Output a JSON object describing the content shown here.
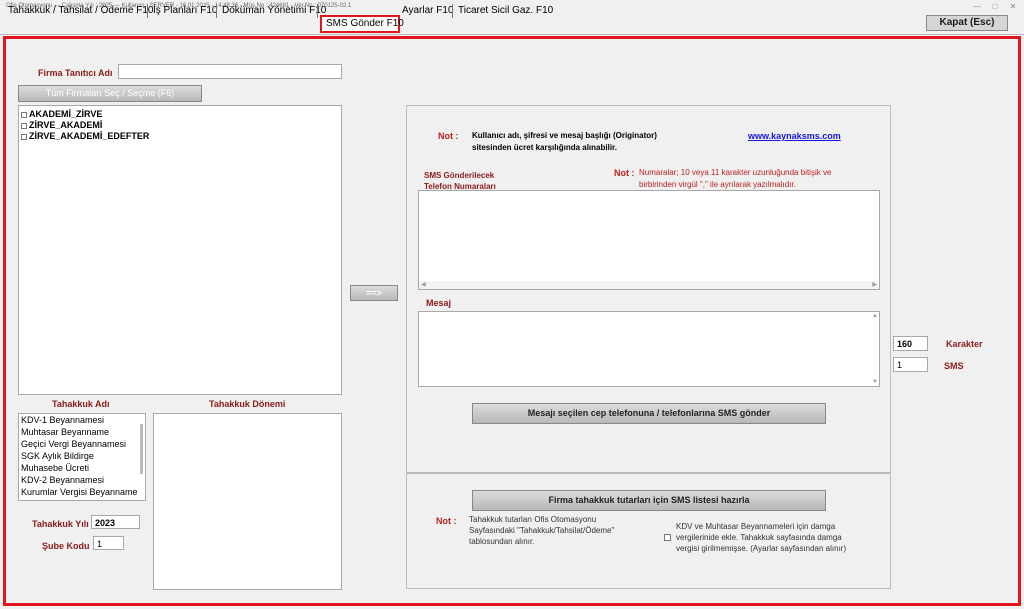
{
  "titlebar": {
    "text": "Ofis Otomasyonu  ---  Çalışma Yılı : 2025  ---  Kullanıcı : SERVER - 16.01.2025 - 14:48:36 - Müş.No : 424681 - Ver.No : 070125-02.1"
  },
  "tabs": [
    {
      "label": "Tahakkuk / Tahsilat / Ödeme F10"
    },
    {
      "label": "İş Planları F10"
    },
    {
      "label": "Döküman Yönetimi F10"
    },
    {
      "label": "SMS Gönder F10"
    },
    {
      "label": "Ayarlar F10"
    },
    {
      "label": "Ticaret Sicil Gaz. F10"
    }
  ],
  "close_button": "Kapat (Esc)",
  "left": {
    "firm_label": "Firma Tanıtıcı Adı",
    "firm_value": "",
    "select_all_button": "Tüm Firmaları Seç / Seçme (F6)",
    "firms": [
      "AKADEMİ_ZİRVE",
      "ZİRVE_AKADEMİ",
      "ZİRVE_AKADEMİ_EDEFTER"
    ],
    "tahakkuk_adi_label": "Tahakkuk Adı",
    "tahakkuk_donemi_label": "Tahakkuk Dönemi",
    "tahakkuk_items": [
      "KDV-1 Beyannamesi",
      "Muhtasar Beyanname",
      "Geçici Vergi Beyannamesi",
      "SGK Aylık Bildirge",
      "Muhasebe Ücreti",
      "KDV-2 Beyannamesi",
      "Kurumlar Vergisi Beyanname"
    ],
    "year_label": "Tahakkuk Yılı",
    "year_value": "2023",
    "branch_label": "Şube Kodu",
    "branch_value": "1"
  },
  "arrow_button": "==>",
  "right": {
    "note_label": "Not :",
    "note_text_1": "Kullanıcı adı, şifresi ve mesaj başlığı (Originator)",
    "note_text_2": "sitesinden ücret karşılığında alınabilir.",
    "link": "www.kaynaksms.com",
    "phones_label_1": "SMS Gönderilecek",
    "phones_label_2": "Telefon Numaraları",
    "phones_note_label": "Not :",
    "phones_note_1": "Numaralar; 10 veya 11 karakter uzunluğunda bitişik ve",
    "phones_note_2": "birbirinden virgül \",\" ile ayrılarak yazılmalıdır.",
    "message_label": "Mesaj",
    "char_value": "160",
    "char_label": "Karakter",
    "sms_value": "1",
    "sms_label": "SMS",
    "send_button": "Mesajı seçilen cep telefonuna / telefonlarına SMS gönder",
    "prepare_button": "Firma tahakkuk tutarları için SMS listesi hazırla",
    "bottom_note_label": "Not :",
    "bottom_note_1": "Tahakkuk tutarları Ofis Otomasyonu",
    "bottom_note_2": "Sayfasındaki \"Tahakkuk/Tahsilat/Ödeme\"",
    "bottom_note_3": "tablosundan alınır.",
    "kdv_check_1": "KDV ve Muhtasar Beyannameleri için damga",
    "kdv_check_2": "vergilerinide ekle. Tahakkuk sayfasında damga",
    "kdv_check_3": "vergisi girilmemişse. (Ayarlar sayfasından alınır)"
  }
}
